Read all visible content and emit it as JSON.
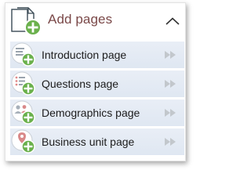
{
  "header": {
    "title": "Add pages",
    "icon": "add-page-icon",
    "collapse_icon": "chevron-up-icon"
  },
  "items": [
    {
      "label": "Introduction page",
      "icon": "introduction-page-icon",
      "action_icon": "double-arrow-right-icon"
    },
    {
      "label": "Questions page",
      "icon": "questions-page-icon",
      "action_icon": "double-arrow-right-icon"
    },
    {
      "label": "Demographics page",
      "icon": "demographics-page-icon",
      "action_icon": "double-arrow-right-icon"
    },
    {
      "label": "Business unit page",
      "icon": "business-unit-page-icon",
      "action_icon": "double-arrow-right-icon"
    }
  ],
  "colors": {
    "title": "#7a4848",
    "add_badge": "#6ab04c",
    "item_background": "#e4ebf4",
    "arrow": "#c2c7cc"
  }
}
